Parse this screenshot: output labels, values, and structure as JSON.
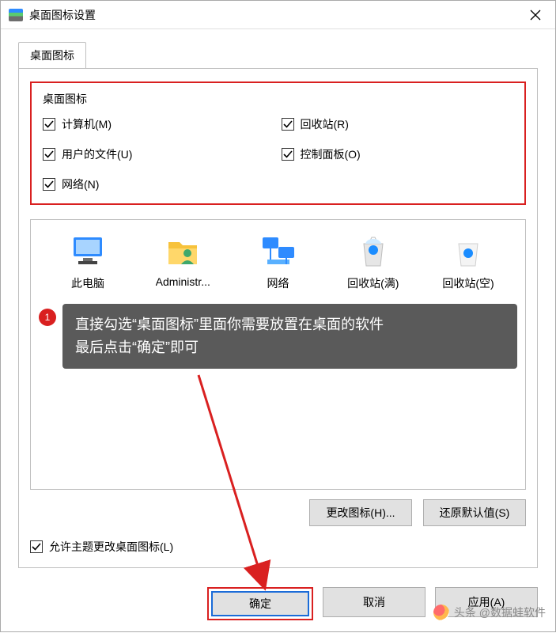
{
  "window": {
    "title": "桌面图标设置"
  },
  "tab": {
    "label": "桌面图标"
  },
  "group": {
    "title": "桌面图标",
    "items": [
      {
        "label": "计算机(M)"
      },
      {
        "label": "回收站(R)"
      },
      {
        "label": "用户的文件(U)"
      },
      {
        "label": "控制面板(O)"
      },
      {
        "label": "网络(N)"
      }
    ]
  },
  "icons": [
    {
      "label": "此电脑"
    },
    {
      "label": "Administr..."
    },
    {
      "label": "网络"
    },
    {
      "label": "回收站(满)"
    },
    {
      "label": "回收站(空)"
    }
  ],
  "hint": {
    "badge": "1",
    "line1": "直接勾选“桌面图标”里面你需要放置在桌面的软件",
    "line2": "最后点击“确定”即可"
  },
  "buttons": {
    "change_icon": "更改图标(H)...",
    "restore_default": "还原默认值(S)",
    "ok": "确定",
    "cancel": "取消",
    "apply": "应用(A)"
  },
  "allow_theme": {
    "label": "允许主题更改桌面图标(L)"
  },
  "watermark": {
    "text": "头条 @数据蛙软件"
  }
}
